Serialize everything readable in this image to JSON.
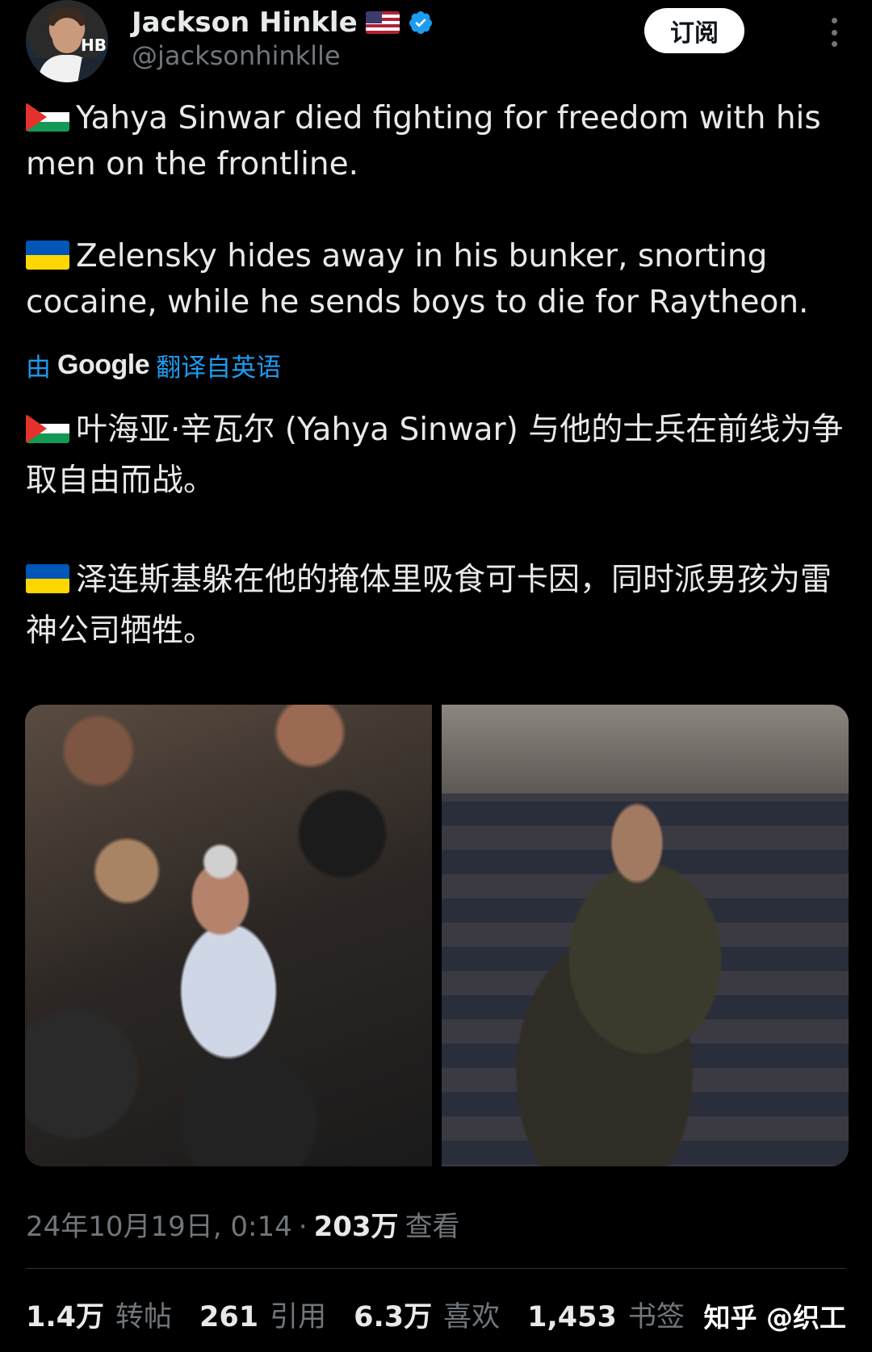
{
  "author": {
    "name": "Jackson Hinkle",
    "handle": "@jacksonhinklle",
    "flag_icon": "us-flag-icon",
    "verified_icon": "verified-badge-icon",
    "avatar_text": "HB"
  },
  "subscribe_label": "订阅",
  "post": {
    "line1": "Yahya Sinwar died fighting for freedom with his men on the frontline.",
    "line2": "Zelensky hides away in his bunker, snorting cocaine, while he sends boys to die for Raytheon."
  },
  "translation": {
    "by": "由",
    "provider": "Google",
    "link": "翻译自英语",
    "line1": "叶海亚·辛瓦尔 (Yahya Sinwar) 与他的士兵在前线为争取自由而战。",
    "line2": "泽连斯基躲在他的掩体里吸食可卡因，同时派男孩为雷神公司牺牲。"
  },
  "meta": {
    "datetime": "24年10月19日, 0:14",
    "separator": "·",
    "views": "203万",
    "views_label": "查看"
  },
  "stats": {
    "reposts": "1.4万",
    "reposts_label": "转帖",
    "quotes": "261",
    "quotes_label": "引用",
    "likes": "6.3万",
    "likes_label": "喜欢",
    "bookmarks": "1,453",
    "bookmarks_label": "书签"
  },
  "watermark": "知乎 @织工",
  "colors": {
    "background": "#000000",
    "text": "#e7e9ea",
    "secondary": "#71767b",
    "link": "#1d9bf0"
  }
}
